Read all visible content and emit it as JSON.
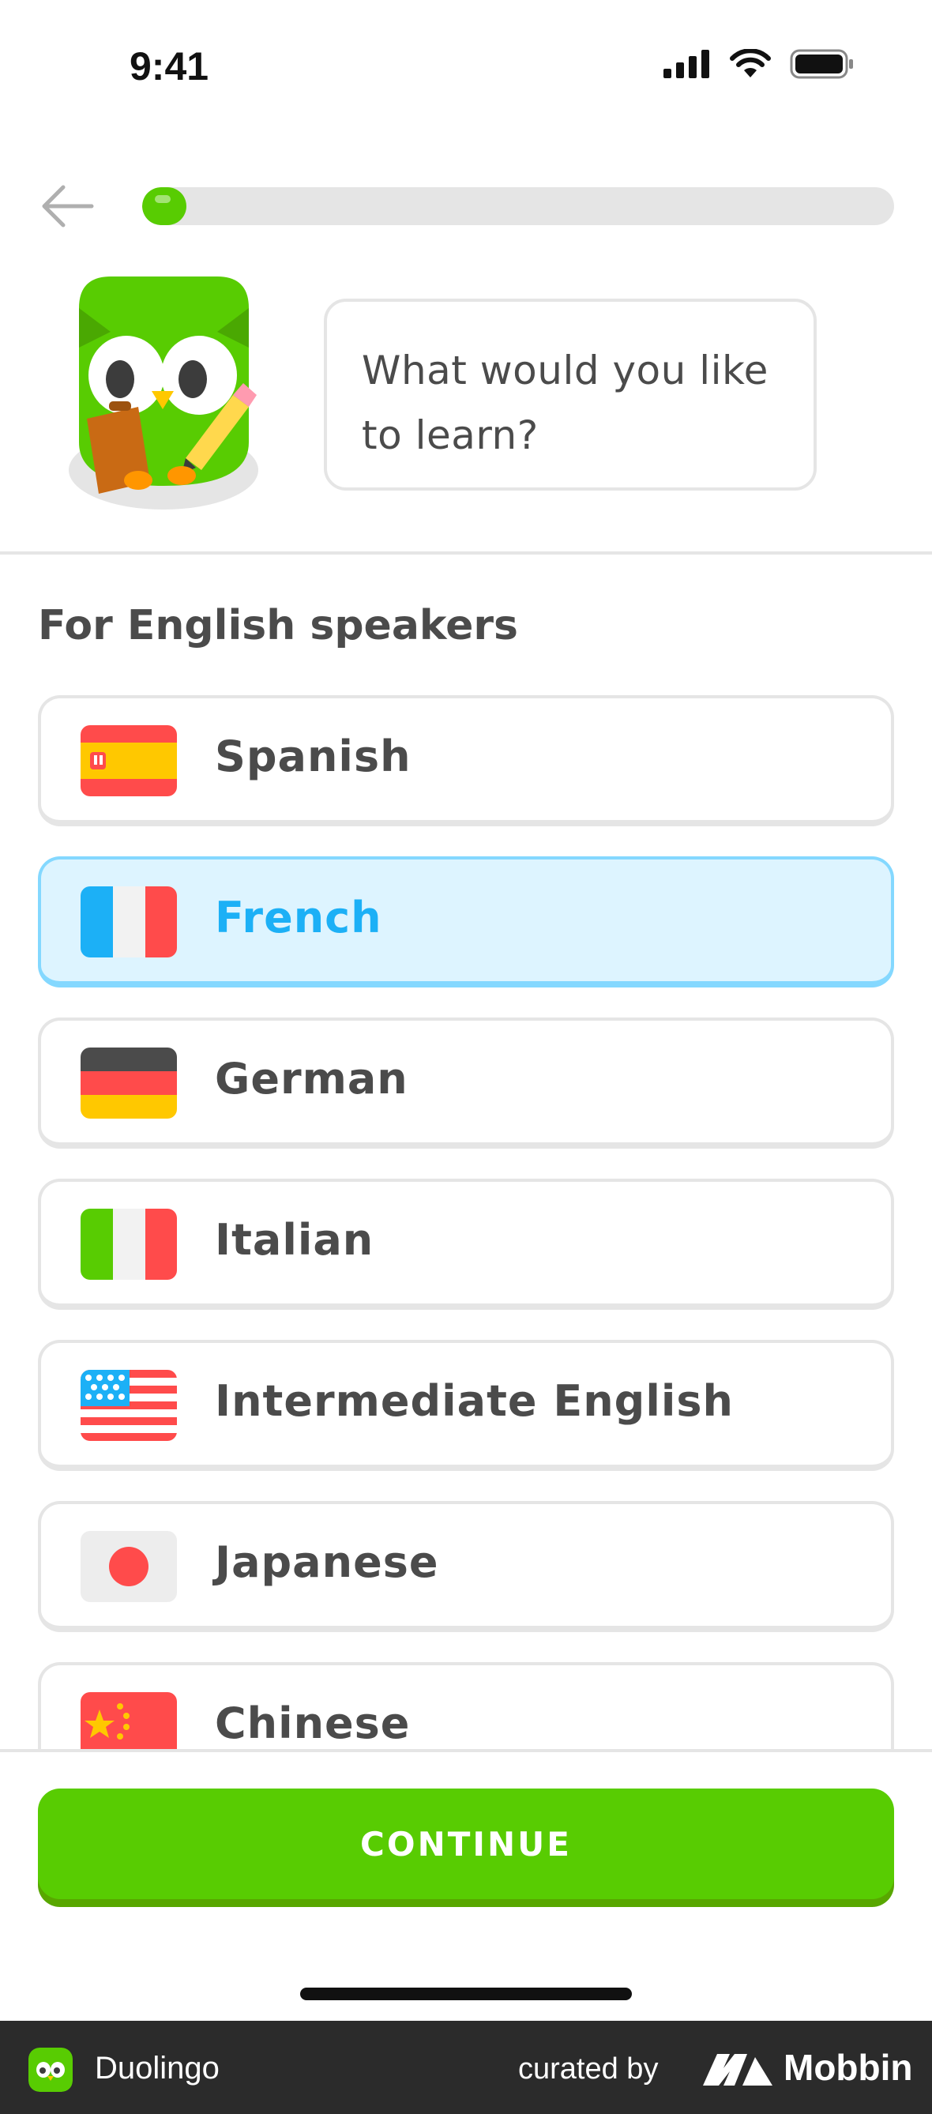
{
  "status_bar": {
    "time": "9:41"
  },
  "header": {
    "progress_fraction": 0.05
  },
  "prompt": {
    "text": "What would you like to learn?"
  },
  "section": {
    "title": "For English speakers"
  },
  "languages": [
    {
      "label": "Spanish",
      "flag": "spain-flag-icon",
      "selected": false
    },
    {
      "label": "French",
      "flag": "france-flag-icon",
      "selected": true
    },
    {
      "label": "German",
      "flag": "germany-flag-icon",
      "selected": false
    },
    {
      "label": "Italian",
      "flag": "italy-flag-icon",
      "selected": false
    },
    {
      "label": "Intermediate English",
      "flag": "usa-flag-icon",
      "selected": false
    },
    {
      "label": "Japanese",
      "flag": "japan-flag-icon",
      "selected": false
    },
    {
      "label": "Chinese",
      "flag": "china-flag-icon",
      "selected": false
    }
  ],
  "footer": {
    "continue_label": "CONTINUE"
  },
  "brand_bar": {
    "app_name": "Duolingo",
    "curated_by": "curated by",
    "brand": "Mobbin"
  },
  "colors": {
    "green": "#58cc02",
    "blue": "#1cb0f6",
    "selected_bg": "#ddf4ff",
    "text": "#4b4b4b"
  }
}
